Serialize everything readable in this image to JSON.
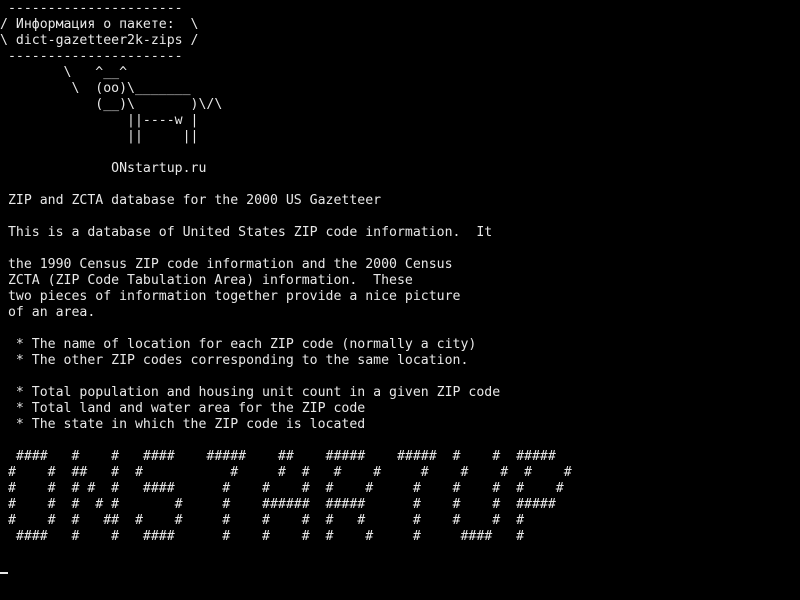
{
  "terminal": {
    "lines": [
      " ----------------------",
      "/ Информация о пакете:  \\",
      "\\ dict-gazetteer2k-zips /",
      " ----------------------",
      "        \\   ^__^",
      "         \\  (oo)\\_______",
      "            (__)\\       )\\/\\",
      "                ||----w |",
      "                ||     ||",
      "",
      "              ONstartup.ru",
      "",
      " ZIP and ZCTA database for the 2000 US Gazetteer",
      "",
      " This is a database of United States ZIP code information.  It",
      "",
      " the 1990 Census ZIP code information and the 2000 Census",
      " ZCTA (ZIP Code Tabulation Area) information.  These",
      " two pieces of information together provide a nice picture",
      " of an area.",
      "",
      "  * The name of location for each ZIP code (normally a city)",
      "  * The other ZIP codes corresponding to the same location.",
      "",
      "  * Total population and housing unit count in a given ZIP code",
      "  * Total land and water area for the ZIP code",
      "  * The state in which the ZIP code is located",
      "",
      "  ####   #    #   ####    #####    ##    #####    #####  #    #  #####",
      " #    #  ##   #  #           #     #  #   #    #     #    #    #  #    #",
      " #    #  # #  #   ####      #    #    #  #    #     #    #    #  #    #",
      " #    #  #  # #       #     #    ######  #####      #    #    #  #####",
      " #    #  #   ##  #    #     #    #    #  #   #      #    #    #  #",
      "  ####   #    #   ####      #    #    #  #    #     #     ####   #",
      ""
    ]
  }
}
